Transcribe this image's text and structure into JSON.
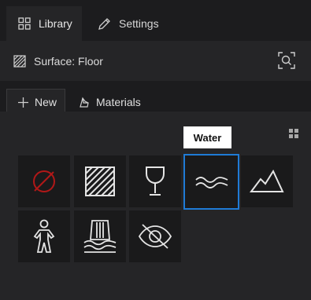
{
  "tabs": {
    "library_label": "Library",
    "settings_label": "Settings"
  },
  "surface": {
    "label": "Surface: Floor"
  },
  "subtabs": {
    "new_label": "New",
    "materials_label": "Materials"
  },
  "tooltip": {
    "text": "Water"
  },
  "tiles": [
    {
      "name": "none",
      "icon": "no-material-icon"
    },
    {
      "name": "hatch",
      "icon": "hatch-pattern-icon"
    },
    {
      "name": "glass",
      "icon": "wine-glass-icon"
    },
    {
      "name": "water",
      "icon": "water-waves-icon",
      "selected": true
    },
    {
      "name": "mountain",
      "icon": "mountain-icon"
    },
    {
      "name": "person",
      "icon": "person-icon"
    },
    {
      "name": "waterfall",
      "icon": "waterfall-icon"
    },
    {
      "name": "hidden",
      "icon": "eye-slash-icon"
    }
  ],
  "colors": {
    "background": "#1c1c1e",
    "panel": "#252527",
    "tile": "#1a1a1b",
    "selection": "#1f7bd6",
    "none_icon": "#b01818"
  }
}
